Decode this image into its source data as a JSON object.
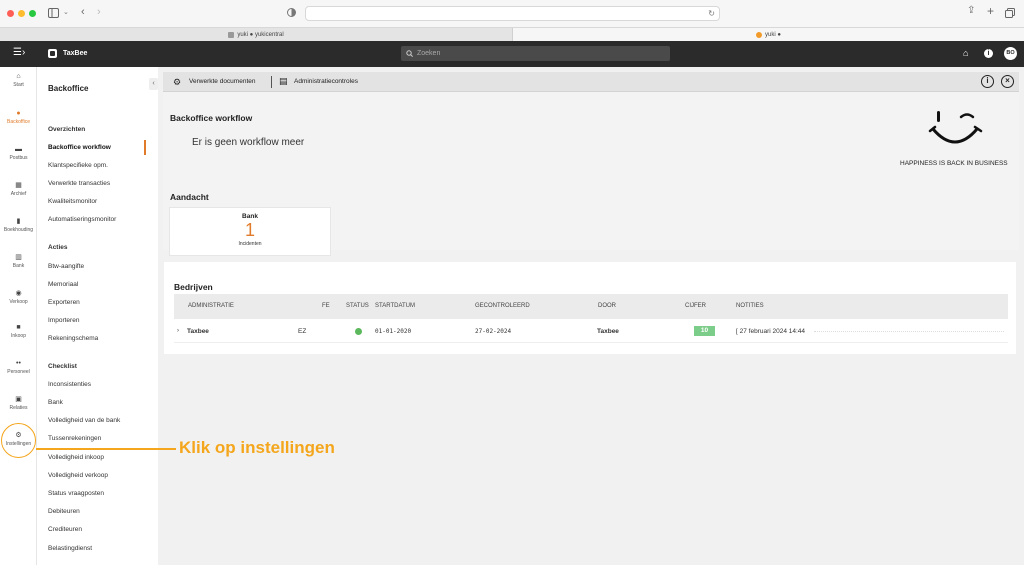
{
  "browser": {
    "tabs": [
      {
        "label": "yuki ● yukicentral",
        "favicon": "y-favicon"
      },
      {
        "label": "yuki ●",
        "favicon": "yuki-favicon"
      }
    ]
  },
  "app": {
    "logo": "TaxBee",
    "search_placeholder": "Zoeken",
    "avatar": "BO"
  },
  "rail": [
    {
      "label": "Start",
      "icon": "home-icon"
    },
    {
      "label": "Backoffice",
      "icon": "backoffice-icon",
      "active": true
    },
    {
      "label": "Postbus",
      "icon": "inbox-icon"
    },
    {
      "label": "Archief",
      "icon": "archive-icon"
    },
    {
      "label": "Boekhouding",
      "icon": "chart-icon"
    },
    {
      "label": "Bank",
      "icon": "bank-icon"
    },
    {
      "label": "Verkoop",
      "icon": "sales-icon"
    },
    {
      "label": "Inkoop",
      "icon": "truck-icon"
    },
    {
      "label": "Personeel",
      "icon": "people-icon"
    },
    {
      "label": "Relaties",
      "icon": "contacts-icon"
    },
    {
      "label": "Instellingen",
      "icon": "gear-icon"
    }
  ],
  "nav": {
    "title": "Backoffice",
    "sections": [
      {
        "title": "Overzichten",
        "items": [
          "Backoffice workflow",
          "Klantspecifieke opm.",
          "Verwerkte transacties",
          "Kwaliteitsmonitor",
          "Automatiseringsmonitor"
        ]
      },
      {
        "title": "Acties",
        "items": [
          "Btw-aangifte",
          "Memoriaal",
          "Exporteren",
          "Importeren",
          "Rekeningschema"
        ]
      },
      {
        "title": "Checklist",
        "items": [
          "Inconsistenties",
          "Bank",
          "Volledigheid van de bank",
          "Tussenrekeningen",
          "Volledigheid inkoop",
          "Volledigheid verkoop",
          "Status vraagposten",
          "Debiteuren",
          "Crediteuren",
          "Belastingdienst"
        ]
      }
    ]
  },
  "toolbar": {
    "verwerkte_label": "Verwerkte documenten",
    "admin_label": "Administratiecontroles"
  },
  "workflow": {
    "title": "Backoffice workflow",
    "empty_message": "Er is geen workflow meer",
    "tagline": "HAPPINESS IS BACK IN BUSINESS"
  },
  "aandacht": {
    "title": "Aandacht",
    "card_title": "Bank",
    "card_count": "1",
    "card_label": "Incidenten"
  },
  "bedrijven": {
    "title": "Bedrijven",
    "columns": [
      "ADMINISTRATIE",
      "FE",
      "STATUS",
      "STARTDATUM",
      "GECONTROLEERD",
      "DOOR",
      "CIJFER",
      "NOTITIES"
    ],
    "rows": [
      {
        "name": "Taxbee",
        "fe": "EZ",
        "status_color": "#5cb85c",
        "start": "01-01-2020",
        "checked": "27-02-2024",
        "by": "Taxbee",
        "grade": "10",
        "note": "[ 27 februari 2024 14:44"
      }
    ]
  },
  "annotation": {
    "text": "Klik op instellingen"
  },
  "colors": {
    "accent": "#e07b2b",
    "annotation": "#f4a61d",
    "grade": "#7ccc8a"
  }
}
